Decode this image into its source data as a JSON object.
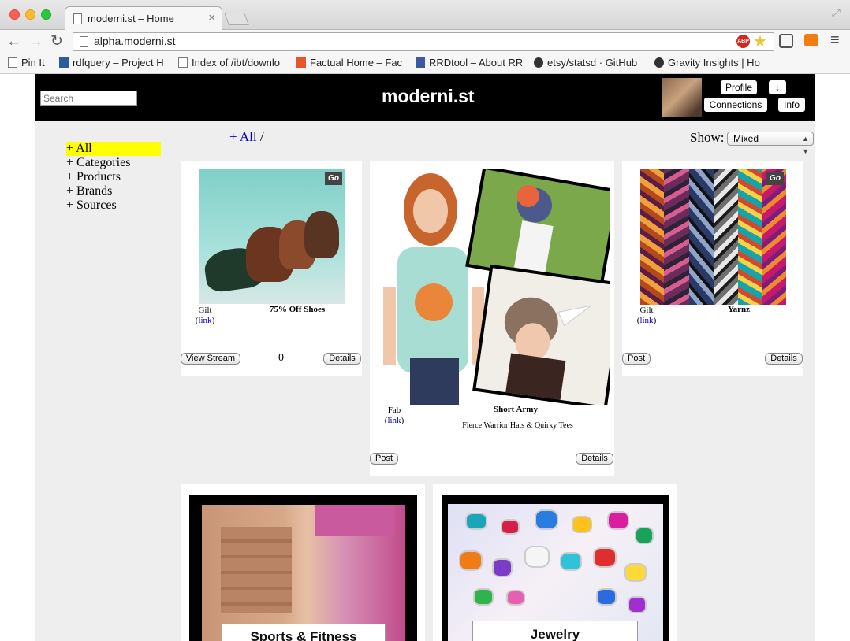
{
  "browser": {
    "tab_title": "moderni.st – Home",
    "tab_close": "×",
    "url": "alpha.moderni.st",
    "abp_label": "ABP",
    "bookmarks": [
      "Pin It",
      "rdfquery – Project H",
      "Index of /ibt/downlo",
      "Factual Home – Fact",
      "RRDtool – About RRD",
      "etsy/statsd · GitHub",
      "Gravity Insights | Ho"
    ]
  },
  "header": {
    "search_placeholder": "Search",
    "logo": "moderni.st",
    "buttons": {
      "profile": "Profile",
      "down": "↓",
      "connections": "Connections",
      "info": "Info"
    }
  },
  "breadcrumb": {
    "all": "+ All",
    "sep": "/"
  },
  "filter": {
    "label": "Show:",
    "value": "Mixed"
  },
  "sidebar": {
    "items": [
      {
        "label": "+ All",
        "selected": true
      },
      {
        "label": "+ Categories"
      },
      {
        "label": "+ Products"
      },
      {
        "label": "+ Brands"
      },
      {
        "label": "+ Sources"
      }
    ]
  },
  "cards": [
    {
      "source": "Gilt",
      "link": "link",
      "title": "75% Off Shoes",
      "go": "Go",
      "view_stream": "View Stream",
      "count": "0",
      "details": "Details"
    },
    {
      "source": "Fab",
      "link": "link",
      "title": "Short Army",
      "subtitle": "Fierce Warrior Hats & Quirky Tees",
      "post": "Post",
      "details": "Details"
    },
    {
      "source": "Gilt",
      "link": "link",
      "title": "Yarnz",
      "go": "Go",
      "post": "Post",
      "details": "Details"
    }
  ],
  "tiles": [
    {
      "label": "Sports & Fitness"
    },
    {
      "label": "Jewelry"
    }
  ],
  "colors": {
    "sidebar_highlight": "#ffff00",
    "link": "#0000cc",
    "header_bg": "#000000",
    "page_bg": "#eeeeee"
  }
}
